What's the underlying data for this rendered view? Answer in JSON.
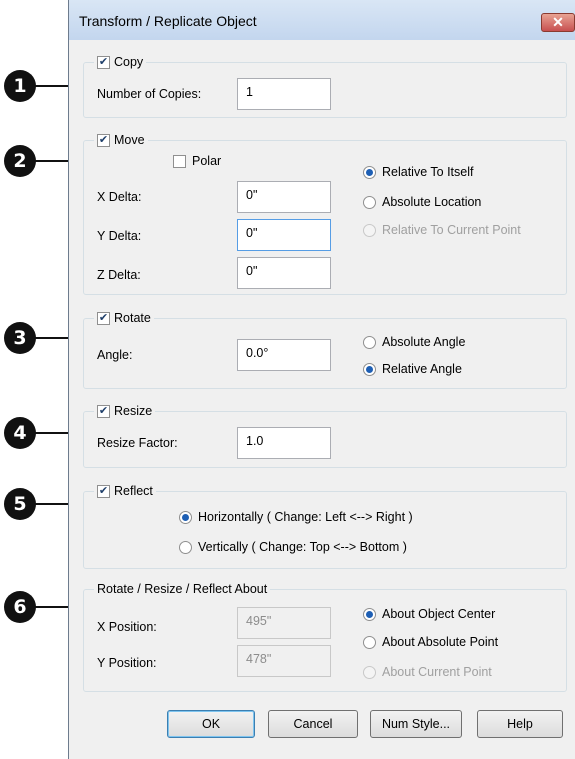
{
  "dialog": {
    "title": "Transform / Replicate Object",
    "close_glyph": "✕"
  },
  "callouts": [
    "1",
    "2",
    "3",
    "4",
    "5",
    "6"
  ],
  "copy": {
    "label": "Copy",
    "checked": true,
    "count_label": "Number of Copies:",
    "count_value": "1"
  },
  "move": {
    "label": "Move",
    "checked": true,
    "polar_label": "Polar",
    "polar_checked": false,
    "x_label": "X Delta:",
    "x_value": "0\"",
    "y_label": "Y Delta:",
    "y_value": "0\"",
    "z_label": "Z Delta:",
    "z_value": "0\"",
    "options": [
      "Relative To Itself",
      "Absolute Location",
      "Relative To Current Point"
    ],
    "selected": "Relative To Itself"
  },
  "rotate": {
    "label": "Rotate",
    "checked": true,
    "angle_label": "Angle:",
    "angle_value": "0.0°",
    "options": [
      "Absolute Angle",
      "Relative Angle"
    ],
    "selected": "Relative Angle"
  },
  "resize": {
    "label": "Resize",
    "checked": true,
    "factor_label": "Resize Factor:",
    "factor_value": "1.0"
  },
  "reflect": {
    "label": "Reflect",
    "checked": true,
    "options": [
      "Horizontally ( Change: Left <--> Right )",
      "Vertically ( Change: Top <--> Bottom )"
    ],
    "selected": "Horizontally ( Change: Left <--> Right )"
  },
  "about": {
    "label": "Rotate / Resize / Reflect About",
    "x_label": "X Position:",
    "x_value": "495\"",
    "y_label": "Y Position:",
    "y_value": "478\"",
    "options": [
      "About Object Center",
      "About Absolute Point",
      "About Current Point"
    ],
    "selected": "About Object Center"
  },
  "buttons": {
    "ok": "OK",
    "cancel": "Cancel",
    "num_style": "Num Style...",
    "help": "Help"
  },
  "colors": {
    "radio_selected": "#1e5fb4",
    "close_button": "#c75050",
    "titlebar": "#c3d6ee"
  }
}
